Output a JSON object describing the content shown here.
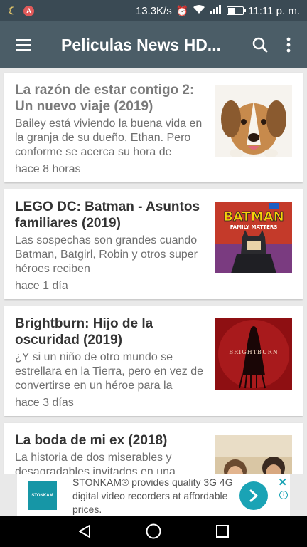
{
  "status_bar": {
    "net_speed": "13.3K/s",
    "time": "11:11 p. m.",
    "app_badge": "A",
    "battery_level": 0.45
  },
  "app_bar": {
    "title": "Peliculas News HD..."
  },
  "feed": [
    {
      "title": "La razón de estar contigo 2: Un nuevo viaje (2019)",
      "description": "Bailey está viviendo la buena vida en la granja de su dueño, Ethan. Pero conforme se acerca su hora de",
      "time_ago": "hace 8 horas",
      "muted": true
    },
    {
      "title": "LEGO DC: Batman - Asuntos familiares (2019)",
      "description": "Las sospechas son grandes cuando Batman, Batgirl, Robin y otros super héroes reciben",
      "time_ago": "hace 1 día",
      "poster_title": "BATMAN",
      "poster_subtitle": "FAMILY MATTERS"
    },
    {
      "title": "Brightburn: Hijo de la oscuridad (2019)",
      "description": "¿Y si un niño de otro mundo se estrellara en la Tierra, pero en vez de convertirse en un héroe para la",
      "time_ago": "hace 3 días",
      "poster_title": "BRIGHTBURN"
    },
    {
      "title": "La boda de mi ex (2018)",
      "description": "La historia de dos miserables y desagradables invitados en una",
      "time_ago": ""
    }
  ],
  "ad": {
    "brand": "STONKAM",
    "text": "STONKAM® provides quality 3G 4G digital video recorders at affordable prices."
  },
  "colors": {
    "status_bar": "#3a4a54",
    "app_bar": "#4b5d67",
    "ad_accent": "#1aa3b5"
  }
}
